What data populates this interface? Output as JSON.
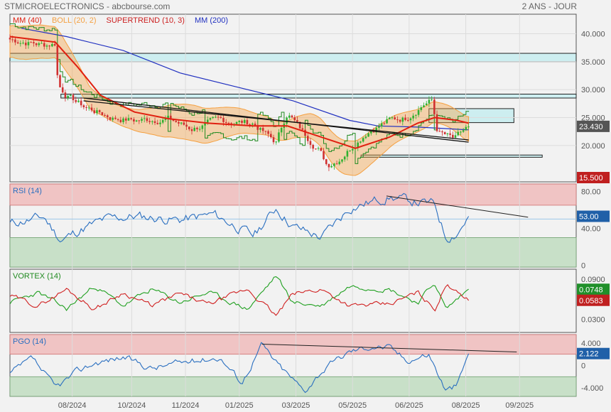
{
  "header": {
    "title": "STMICROELECTRONICS - abcbourse.com",
    "period": "2 ANS - JOUR"
  },
  "colors": {
    "mm40": "#e02010",
    "boll": "#f5a040",
    "supertrend": "#cc2020",
    "mm200": "#2030c0",
    "rsi": "#2a6fc0",
    "vortex_plus": "#20a020",
    "vortex_minus": "#d02020",
    "pgo": "#2a6fc0",
    "zone_red": "#f0c4c4",
    "zone_green": "#c8e0c8",
    "zone_cyan": "#cdeef0",
    "up_candle": "#30b030",
    "down_candle": "#d03030"
  },
  "chart_data": [
    {
      "type": "candlestick",
      "panel": "price",
      "legend": [
        {
          "id": "mm40",
          "label": "MM (40)"
        },
        {
          "id": "boll",
          "label": "BOLL (20, 2)"
        },
        {
          "id": "supertrend",
          "label": "SUPERTREND (10, 3)"
        },
        {
          "id": "mm200",
          "label": "MM (200)"
        }
      ],
      "ylim": [
        13.5,
        43.5
      ],
      "yticks": [
        "40.000",
        "35.000",
        "30.000",
        "25.000",
        "20.000"
      ],
      "ytick_values": [
        40,
        35,
        30,
        25,
        20
      ],
      "x_labels": [
        "08/2024",
        "10/2024",
        "11/2024",
        "01/2025",
        "03/2025",
        "05/2025",
        "06/2025",
        "08/2025",
        "09/2025"
      ],
      "last_price": "23.430",
      "supertrend_value": "15.500",
      "zones": [
        {
          "low": 35.0,
          "high": 36.5,
          "from": 0.0,
          "to": 1.0
        },
        {
          "low": 28.5,
          "high": 29.2,
          "from": 0.09,
          "to": 1.0
        },
        {
          "low": 24.1,
          "high": 26.6,
          "from": 0.74,
          "to": 0.89
        },
        {
          "low": 17.9,
          "high": 18.3,
          "from": 0.62,
          "to": 0.94
        }
      ],
      "trendlines": [
        {
          "x1": 0.13,
          "y1": 28.5,
          "x2": 0.81,
          "y2": 20.6
        },
        {
          "x1": 0.13,
          "y1": 28.0,
          "x2": 0.81,
          "y2": 21.0
        }
      ],
      "anchors": [
        [
          0,
          39.0
        ],
        [
          0.03,
          38.5
        ],
        [
          0.06,
          38.0
        ],
        [
          0.08,
          38.3
        ],
        [
          0.085,
          31.0
        ],
        [
          0.1,
          29.0
        ],
        [
          0.13,
          27.0
        ],
        [
          0.18,
          25.0
        ],
        [
          0.22,
          24.5
        ],
        [
          0.28,
          24.8
        ],
        [
          0.32,
          23.0
        ],
        [
          0.37,
          24.5
        ],
        [
          0.43,
          24.0
        ],
        [
          0.47,
          20.5
        ],
        [
          0.49,
          26.0
        ],
        [
          0.52,
          22.0
        ],
        [
          0.545,
          19.5
        ],
        [
          0.56,
          16.5
        ],
        [
          0.58,
          17.5
        ],
        [
          0.61,
          20.5
        ],
        [
          0.63,
          22.5
        ],
        [
          0.67,
          24.5
        ],
        [
          0.7,
          25.0
        ],
        [
          0.73,
          27.5
        ],
        [
          0.745,
          28.0
        ],
        [
          0.755,
          22.5
        ],
        [
          0.785,
          21.0
        ],
        [
          0.81,
          23.4
        ]
      ],
      "mm40": [
        [
          0,
          39.5
        ],
        [
          0.08,
          38.5
        ],
        [
          0.12,
          34.0
        ],
        [
          0.16,
          29.0
        ],
        [
          0.22,
          26.0
        ],
        [
          0.28,
          24.8
        ],
        [
          0.35,
          24.0
        ],
        [
          0.43,
          23.5
        ],
        [
          0.49,
          23.5
        ],
        [
          0.55,
          21.5
        ],
        [
          0.61,
          19.5
        ],
        [
          0.67,
          21.5
        ],
        [
          0.72,
          24.0
        ],
        [
          0.75,
          25.0
        ],
        [
          0.79,
          24.5
        ],
        [
          0.81,
          24.0
        ]
      ],
      "mm200": [
        [
          0.02,
          41.0
        ],
        [
          0.1,
          39.5
        ],
        [
          0.2,
          37.0
        ],
        [
          0.3,
          33.0
        ],
        [
          0.4,
          30.5
        ],
        [
          0.5,
          28.0
        ],
        [
          0.6,
          24.5
        ],
        [
          0.65,
          23.5
        ],
        [
          0.72,
          23.3
        ],
        [
          0.81,
          22.8
        ]
      ]
    },
    {
      "type": "line",
      "panel": "rsi",
      "label": "RSI (14)",
      "ylim": [
        -2,
        88
      ],
      "yticks": [
        "80.00",
        "40.00",
        "0"
      ],
      "ytick_values": [
        80,
        40,
        0
      ],
      "upper_zone": 65,
      "lower_zone": 30,
      "mid": 50,
      "last_value": "53.00",
      "trendline": {
        "x1": 0.665,
        "y1": 75.0,
        "x2": 0.915,
        "y2": 52.0
      },
      "anchors": [
        [
          0,
          45
        ],
        [
          0.06,
          52
        ],
        [
          0.09,
          27
        ],
        [
          0.13,
          40
        ],
        [
          0.17,
          50
        ],
        [
          0.22,
          53
        ],
        [
          0.3,
          49
        ],
        [
          0.36,
          55
        ],
        [
          0.43,
          32
        ],
        [
          0.47,
          62
        ],
        [
          0.5,
          42
        ],
        [
          0.55,
          30
        ],
        [
          0.6,
          62
        ],
        [
          0.67,
          74
        ],
        [
          0.72,
          68
        ],
        [
          0.75,
          66
        ],
        [
          0.77,
          30
        ],
        [
          0.79,
          35
        ],
        [
          0.81,
          53
        ]
      ]
    },
    {
      "type": "line",
      "panel": "vortex",
      "label": "VORTEX (14)",
      "ylim": [
        0.01,
        0.105
      ],
      "yticks": [
        "0.0900",
        "0.0300"
      ],
      "ytick_values": [
        0.09,
        0.03
      ],
      "plus_last": "0.0748",
      "minus_last": "0.0583",
      "plus_anchors": [
        [
          0,
          0.055
        ],
        [
          0.05,
          0.07
        ],
        [
          0.1,
          0.045
        ],
        [
          0.15,
          0.08
        ],
        [
          0.2,
          0.05
        ],
        [
          0.25,
          0.075
        ],
        [
          0.3,
          0.055
        ],
        [
          0.35,
          0.07
        ],
        [
          0.42,
          0.045
        ],
        [
          0.47,
          0.095
        ],
        [
          0.5,
          0.055
        ],
        [
          0.55,
          0.05
        ],
        [
          0.6,
          0.08
        ],
        [
          0.67,
          0.075
        ],
        [
          0.72,
          0.055
        ],
        [
          0.75,
          0.085
        ],
        [
          0.77,
          0.045
        ],
        [
          0.79,
          0.06
        ],
        [
          0.81,
          0.075
        ]
      ],
      "minus_anchors": [
        [
          0,
          0.065
        ],
        [
          0.05,
          0.05
        ],
        [
          0.1,
          0.075
        ],
        [
          0.15,
          0.045
        ],
        [
          0.2,
          0.07
        ],
        [
          0.25,
          0.05
        ],
        [
          0.3,
          0.068
        ],
        [
          0.35,
          0.052
        ],
        [
          0.42,
          0.075
        ],
        [
          0.47,
          0.035
        ],
        [
          0.5,
          0.068
        ],
        [
          0.55,
          0.075
        ],
        [
          0.6,
          0.05
        ],
        [
          0.67,
          0.052
        ],
        [
          0.72,
          0.07
        ],
        [
          0.75,
          0.045
        ],
        [
          0.77,
          0.08
        ],
        [
          0.79,
          0.075
        ],
        [
          0.81,
          0.058
        ]
      ]
    },
    {
      "type": "line",
      "panel": "pgo",
      "label": "PGO (14)",
      "ylim": [
        -5.5,
        5.5
      ],
      "yticks": [
        "4.000",
        "0",
        "-4.000"
      ],
      "ytick_values": [
        4,
        0,
        -4
      ],
      "upper_zone": 2,
      "lower_zone": -2,
      "last_value": "2.122",
      "trendline": {
        "x1": 0.445,
        "y1": 3.8,
        "x2": 0.895,
        "y2": 2.4
      },
      "anchors": [
        [
          0,
          -1.5
        ],
        [
          0.04,
          1.2
        ],
        [
          0.08,
          -4.0
        ],
        [
          0.12,
          -1.0
        ],
        [
          0.15,
          0.5
        ],
        [
          0.2,
          1.5
        ],
        [
          0.25,
          -0.5
        ],
        [
          0.3,
          0.5
        ],
        [
          0.37,
          1.5
        ],
        [
          0.41,
          -3.0
        ],
        [
          0.445,
          3.8
        ],
        [
          0.47,
          0.5
        ],
        [
          0.52,
          -4.5
        ],
        [
          0.55,
          -1.0
        ],
        [
          0.6,
          2.5
        ],
        [
          0.64,
          3.5
        ],
        [
          0.67,
          3.2
        ],
        [
          0.7,
          1.0
        ],
        [
          0.74,
          2.0
        ],
        [
          0.77,
          -4.5
        ],
        [
          0.79,
          -3.5
        ],
        [
          0.81,
          2.1
        ]
      ]
    }
  ]
}
